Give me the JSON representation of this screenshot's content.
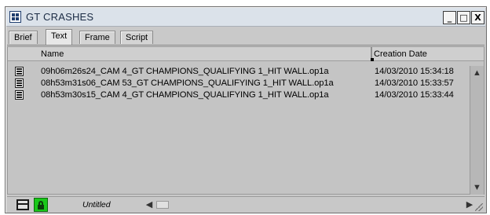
{
  "window": {
    "title": "GT CRASHES",
    "minimize_label": "_",
    "maximize_label": "□",
    "close_label": "X"
  },
  "tabs": [
    {
      "label": "Brief"
    },
    {
      "label": "Text"
    },
    {
      "label": "Frame"
    },
    {
      "label": "Script"
    }
  ],
  "active_tab": "Text",
  "table": {
    "columns": [
      "Name",
      "Creation Date"
    ],
    "rows": [
      {
        "name": "09h06m26s24_CAM 4_GT CHAMPIONS_QUALIFYING 1_HIT WALL.op1a",
        "date": "14/03/2010 15:34:18"
      },
      {
        "name": "08h53m31s06_CAM 53_GT CHAMPIONS_QUALIFYING 1_HIT WALL.op1a",
        "date": "14/03/2010 15:33:57"
      },
      {
        "name": "08h53m30s15_CAM 4_GT CHAMPIONS_QUALIFYING 1_HIT WALL.op1a",
        "date": "14/03/2010 15:33:44"
      }
    ]
  },
  "statusbar": {
    "label": "Untitled"
  },
  "icons": {
    "app": "bin-icon",
    "row": "clip-icon",
    "lock": "lock-icon",
    "view_toggle": "view-toggle-icon"
  },
  "colors": {
    "lock_bg": "#19c819",
    "titlebar_bg": "#dbe2ea",
    "content_bg": "#c4c4c4"
  }
}
